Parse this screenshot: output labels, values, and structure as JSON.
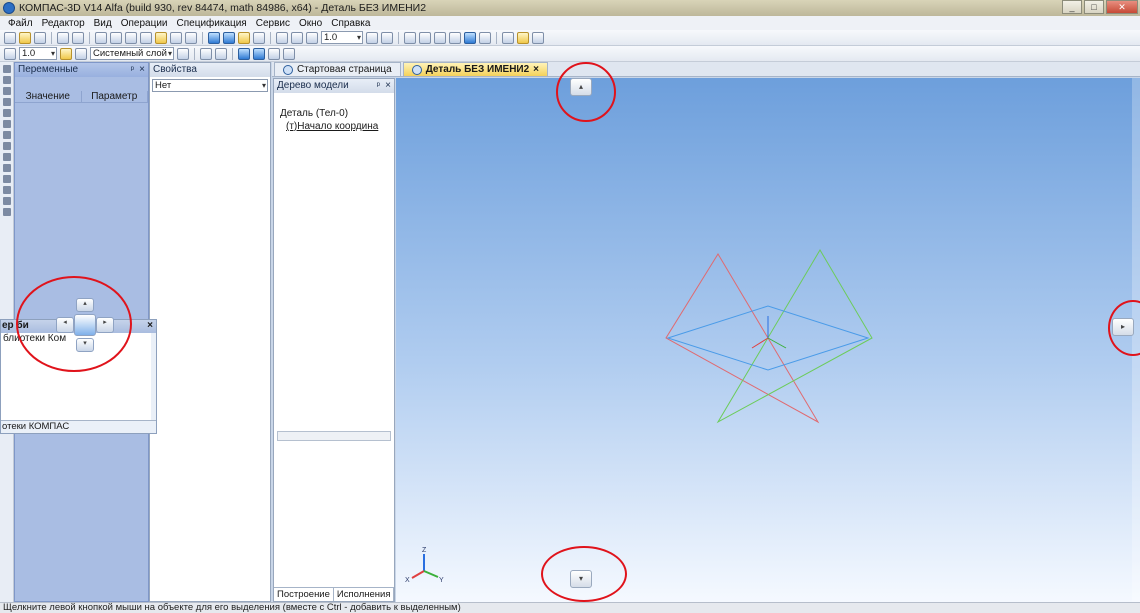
{
  "window": {
    "title": "КОМПАС-3D V14 Alfa (build 930, rev 84474, math 84986, x64) - Деталь БЕЗ ИМЕНИ2",
    "min": "_",
    "max": "□",
    "close": "✕"
  },
  "menu": [
    "Файл",
    "Редактор",
    "Вид",
    "Операции",
    "Спецификация",
    "Сервис",
    "Окно",
    "Справка"
  ],
  "toolbar": {
    "zoom_value": "1.0",
    "step_value": "1.0",
    "layer_value": "Системный слой"
  },
  "variables_panel": {
    "title": "Переменные",
    "columns": [
      "Значение",
      "Параметр"
    ]
  },
  "properties_panel": {
    "title": "Свойства",
    "selector_value": "Нет"
  },
  "tabs": [
    {
      "label": "Стартовая страница"
    },
    {
      "label": "Деталь БЕЗ ИМЕНИ2"
    }
  ],
  "model_tree": {
    "title": "Дерево модели",
    "root": "Деталь (Тел-0)",
    "child": "(т)Начало координа",
    "bottom_tabs": [
      "Построение",
      "Исполнения"
    ]
  },
  "library_window": {
    "title": "ер би",
    "item": "блиотеки Ком",
    "footer": "отеки КОМПАС"
  },
  "axes": {
    "x": "X",
    "y": "Y",
    "z": "Z"
  },
  "colors": {
    "plane_blue": "#4a9be8",
    "plane_red": "#e06a70",
    "plane_green": "#6ccc5a",
    "annotation_red": "#e0131b"
  },
  "status": "Щелкните левой кнопкой мыши на объекте для его выделения (вместе с Ctrl - добавить к выделенным)"
}
